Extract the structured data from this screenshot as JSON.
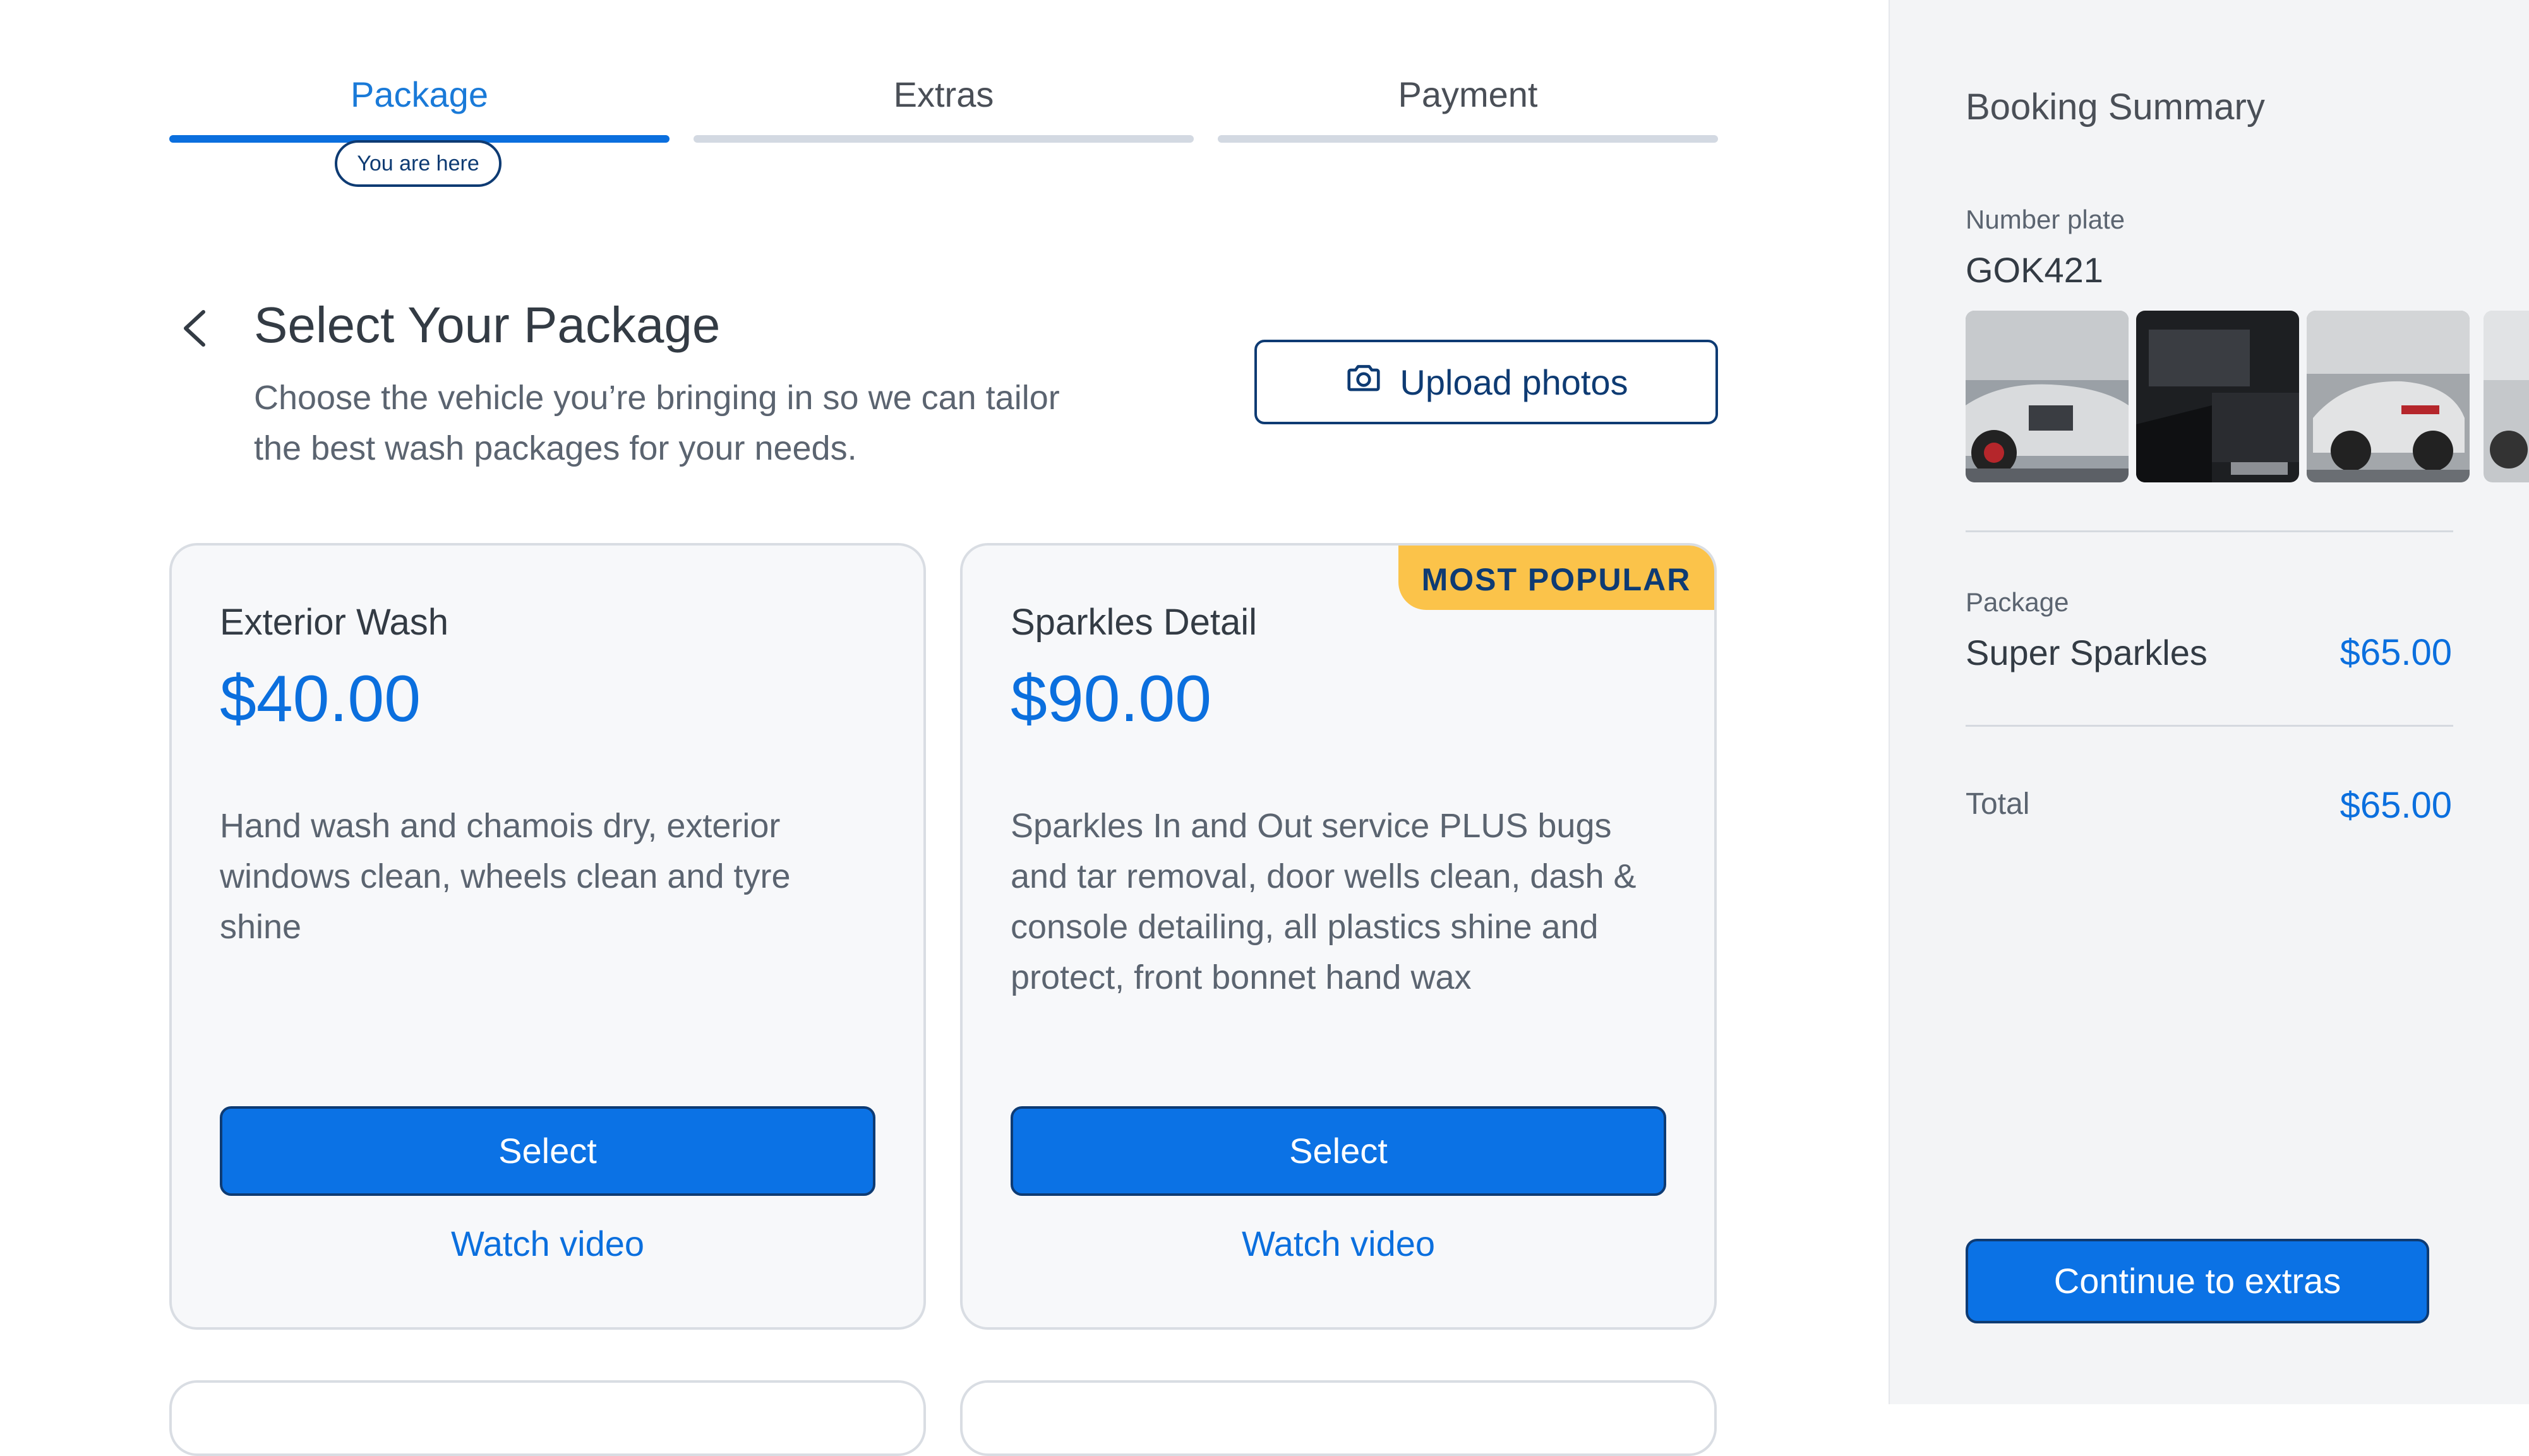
{
  "stepper": {
    "steps": [
      {
        "label": "Package",
        "active": true
      },
      {
        "label": "Extras",
        "active": false
      },
      {
        "label": "Payment",
        "active": false
      }
    ],
    "current_indicator": "You are here"
  },
  "header": {
    "title": "Select Your Package",
    "subtitle": "Choose the vehicle you’re bringing in so we can tailor the best wash packages for your needs.",
    "upload_label": "Upload photos"
  },
  "packages": [
    {
      "name": "Exterior Wash",
      "price": "$40.00",
      "description": "Hand wash and chamois dry, exterior windows clean, wheels clean and tyre shine",
      "select_label": "Select",
      "video_label": "Watch video"
    },
    {
      "name": "Sparkles Detail",
      "price": "$90.00",
      "badge": "MOST POPULAR",
      "description": "Sparkles In and Out service PLUS bugs and tar removal, door wells clean, dash & console detailing, all plastics shine and protect, front bonnet hand wax",
      "select_label": "Select",
      "video_label": "Watch video"
    }
  ],
  "summary": {
    "title": "Booking Summary",
    "plate_label": "Number plate",
    "plate_value": "GOK421",
    "package_label": "Package",
    "package_name": "Super Sparkles",
    "package_price": "$65.00",
    "total_label": "Total",
    "total_price": "$65.00",
    "continue_label": "Continue to extras"
  },
  "colors": {
    "accent": "#0b72e5",
    "navy": "#0e3b73",
    "badge": "#fbc34a",
    "sidebar_bg": "#f3f4f6"
  }
}
